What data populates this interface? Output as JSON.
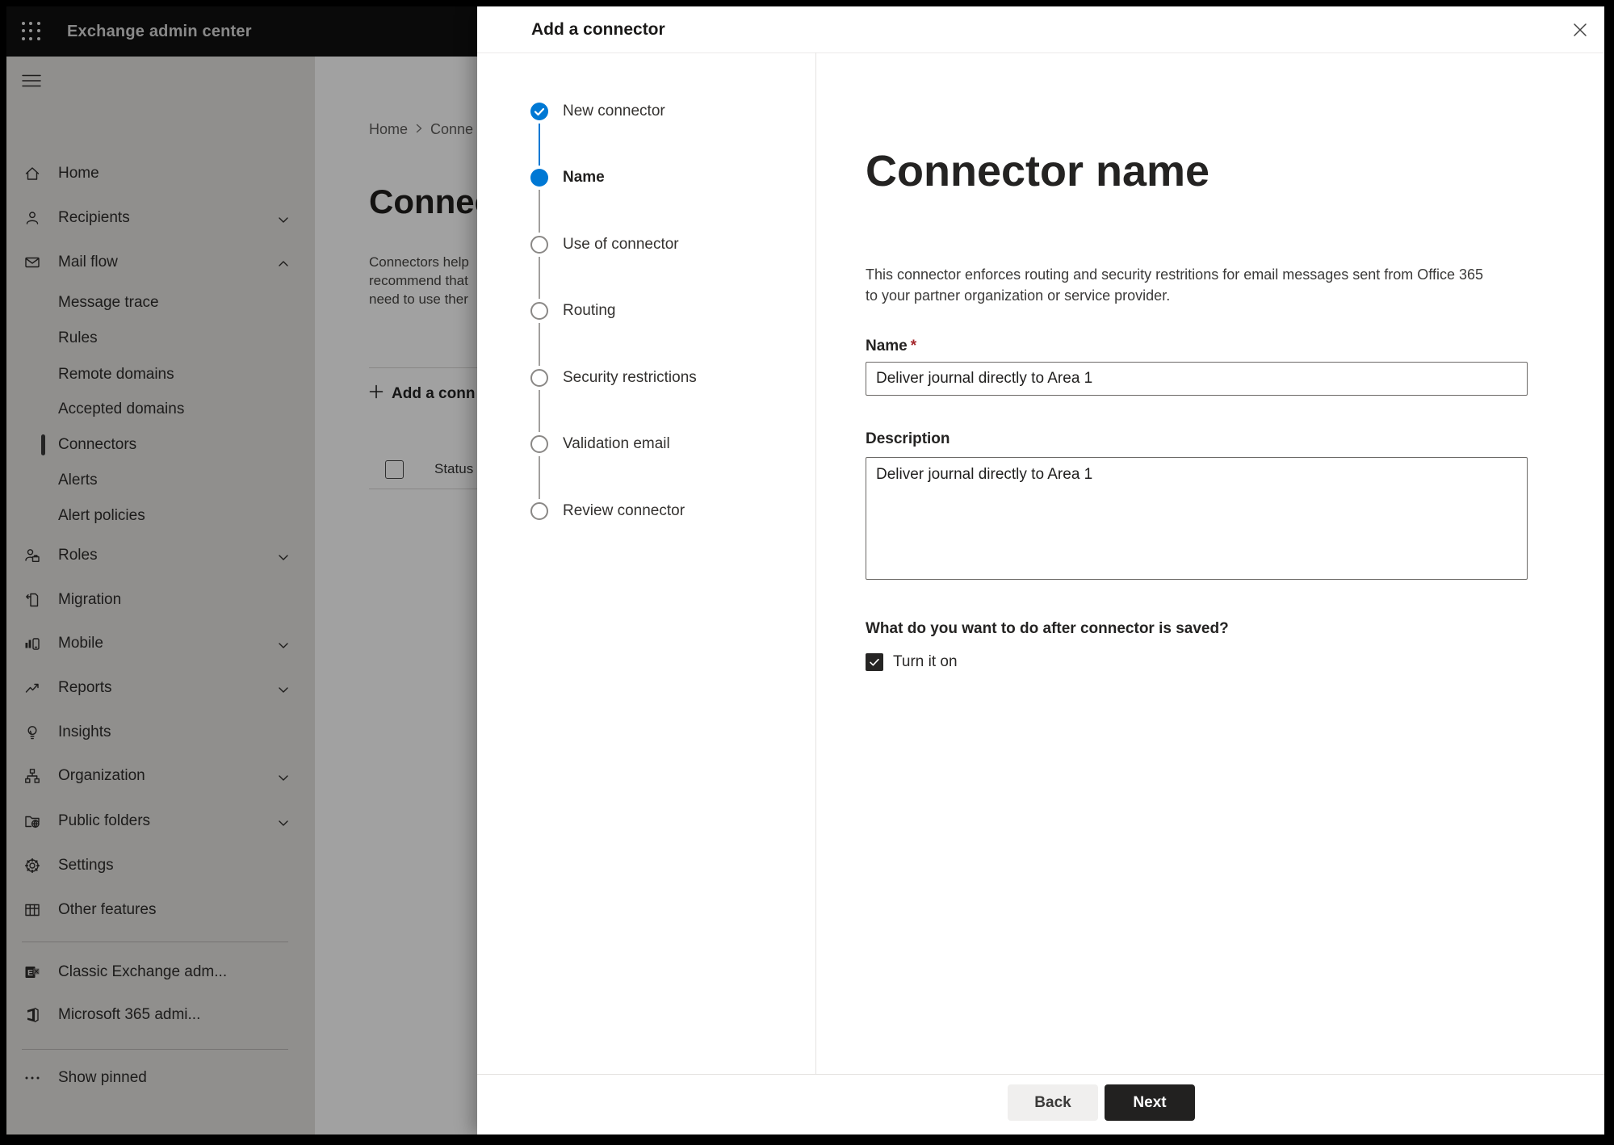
{
  "topbar": {
    "app_title": "Exchange admin center"
  },
  "sidebar": {
    "items": [
      {
        "label": "Home",
        "icon": "home-icon"
      },
      {
        "label": "Recipients",
        "icon": "person-icon",
        "chevron": "down"
      },
      {
        "label": "Mail flow",
        "icon": "mail-icon",
        "chevron": "up",
        "expanded": true
      },
      {
        "label": "Message trace",
        "sub": true
      },
      {
        "label": "Rules",
        "sub": true
      },
      {
        "label": "Remote domains",
        "sub": true
      },
      {
        "label": "Accepted domains",
        "sub": true
      },
      {
        "label": "Connectors",
        "sub": true,
        "selected": true
      },
      {
        "label": "Alerts",
        "sub": true
      },
      {
        "label": "Alert policies",
        "sub": true
      },
      {
        "label": "Roles",
        "icon": "roles-icon",
        "chevron": "down"
      },
      {
        "label": "Migration",
        "icon": "migration-icon"
      },
      {
        "label": "Mobile",
        "icon": "mobile-icon",
        "chevron": "down"
      },
      {
        "label": "Reports",
        "icon": "reports-icon",
        "chevron": "down"
      },
      {
        "label": "Insights",
        "icon": "lightbulb-icon"
      },
      {
        "label": "Organization",
        "icon": "org-tree-icon",
        "chevron": "down"
      },
      {
        "label": "Public folders",
        "icon": "folder-globe-icon",
        "chevron": "down"
      },
      {
        "label": "Settings",
        "icon": "gear-icon"
      },
      {
        "label": "Other features",
        "icon": "table-icon"
      },
      {
        "label": "Classic Exchange adm...",
        "icon": "exchange-logo-icon"
      },
      {
        "label": "Microsoft 365 admi...",
        "icon": "office-logo-icon"
      },
      {
        "label": "Show pinned",
        "icon": "ellipsis-icon"
      }
    ]
  },
  "page": {
    "breadcrumb": {
      "home": "Home",
      "current": "Conne"
    },
    "title": "Connect",
    "intro_lines": [
      "Connectors help",
      "recommend that",
      "need to use ther"
    ],
    "add_button_label": "Add a conn",
    "table": {
      "status_header": "Status"
    }
  },
  "dialog": {
    "title": "Add a connector",
    "steps": [
      {
        "label": "New connector",
        "state": "completed"
      },
      {
        "label": "Name",
        "state": "current"
      },
      {
        "label": "Use of connector",
        "state": "pending"
      },
      {
        "label": "Routing",
        "state": "pending"
      },
      {
        "label": "Security restrictions",
        "state": "pending"
      },
      {
        "label": "Validation email",
        "state": "pending"
      },
      {
        "label": "Review connector",
        "state": "pending"
      }
    ],
    "content": {
      "heading": "Connector name",
      "description_line1": "This connector enforces routing and security restritions for email messages sent from Office 365",
      "description_line2": "to your partner organization or service provider.",
      "name_label": "Name",
      "required_marker": "*",
      "name_value": "Deliver journal directly to Area 1",
      "description_label": "Description",
      "description_value": "Deliver journal directly to Area 1",
      "after_save_question": "What do you want to do after connector is saved?",
      "turn_on_label": "Turn it on",
      "turn_on_checked": true
    },
    "footer": {
      "back_label": "Back",
      "next_label": "Next"
    }
  },
  "colors": {
    "accent_blue": "#0078d4",
    "primary_button": "#222120",
    "required_red": "#a4262c",
    "topbar_bg": "#111111"
  },
  "icons": {
    "app_launcher": "grid-dots",
    "nav_toggle": "hamburger",
    "dialog_close": "x",
    "step_done": "checkmark",
    "add": "plus"
  }
}
